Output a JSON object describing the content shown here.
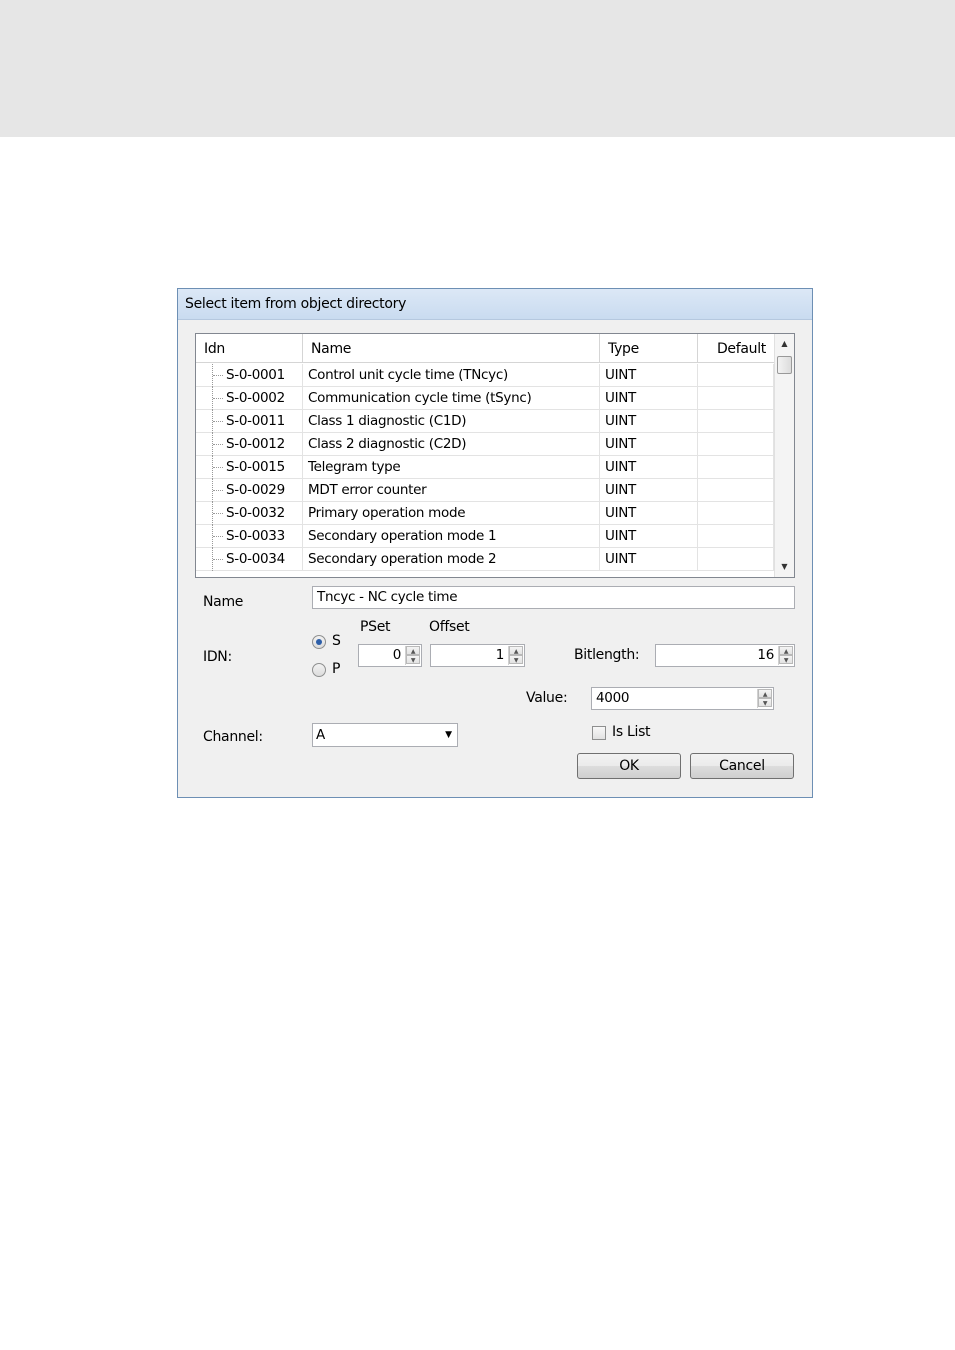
{
  "dialog": {
    "title": "Select item from object directory"
  },
  "grid": {
    "columns": [
      "Idn",
      "Name",
      "Type",
      "Default"
    ],
    "rows": [
      {
        "idn": "S-0-0001",
        "name": "Control unit cycle time (TNcyc)",
        "type": "UINT",
        "default": ""
      },
      {
        "idn": "S-0-0002",
        "name": "Communication cycle time (tSync)",
        "type": "UINT",
        "default": ""
      },
      {
        "idn": "S-0-0011",
        "name": "Class 1 diagnostic (C1D)",
        "type": "UINT",
        "default": ""
      },
      {
        "idn": "S-0-0012",
        "name": "Class 2 diagnostic (C2D)",
        "type": "UINT",
        "default": ""
      },
      {
        "idn": "S-0-0015",
        "name": "Telegram type",
        "type": "UINT",
        "default": ""
      },
      {
        "idn": "S-0-0029",
        "name": "MDT error counter",
        "type": "UINT",
        "default": ""
      },
      {
        "idn": "S-0-0032",
        "name": "Primary operation mode",
        "type": "UINT",
        "default": ""
      },
      {
        "idn": "S-0-0033",
        "name": "Secondary operation mode 1",
        "type": "UINT",
        "default": ""
      },
      {
        "idn": "S-0-0034",
        "name": "Secondary operation mode 2",
        "type": "UINT",
        "default": ""
      }
    ]
  },
  "form": {
    "name_label": "Name",
    "name_value": "Tncyc - NC cycle time",
    "idn_label": "IDN:",
    "radio_s_label": "S",
    "radio_p_label": "P",
    "pset_label": "PSet",
    "pset_value": "0",
    "offset_label": "Offset",
    "offset_value": "1",
    "bitlength_label": "Bitlength:",
    "bitlength_value": "16",
    "value_label": "Value:",
    "value_value": "4000",
    "channel_label": "Channel:",
    "channel_value": "A",
    "is_list_label": "Is List"
  },
  "buttons": {
    "ok": "OK",
    "cancel": "Cancel"
  }
}
